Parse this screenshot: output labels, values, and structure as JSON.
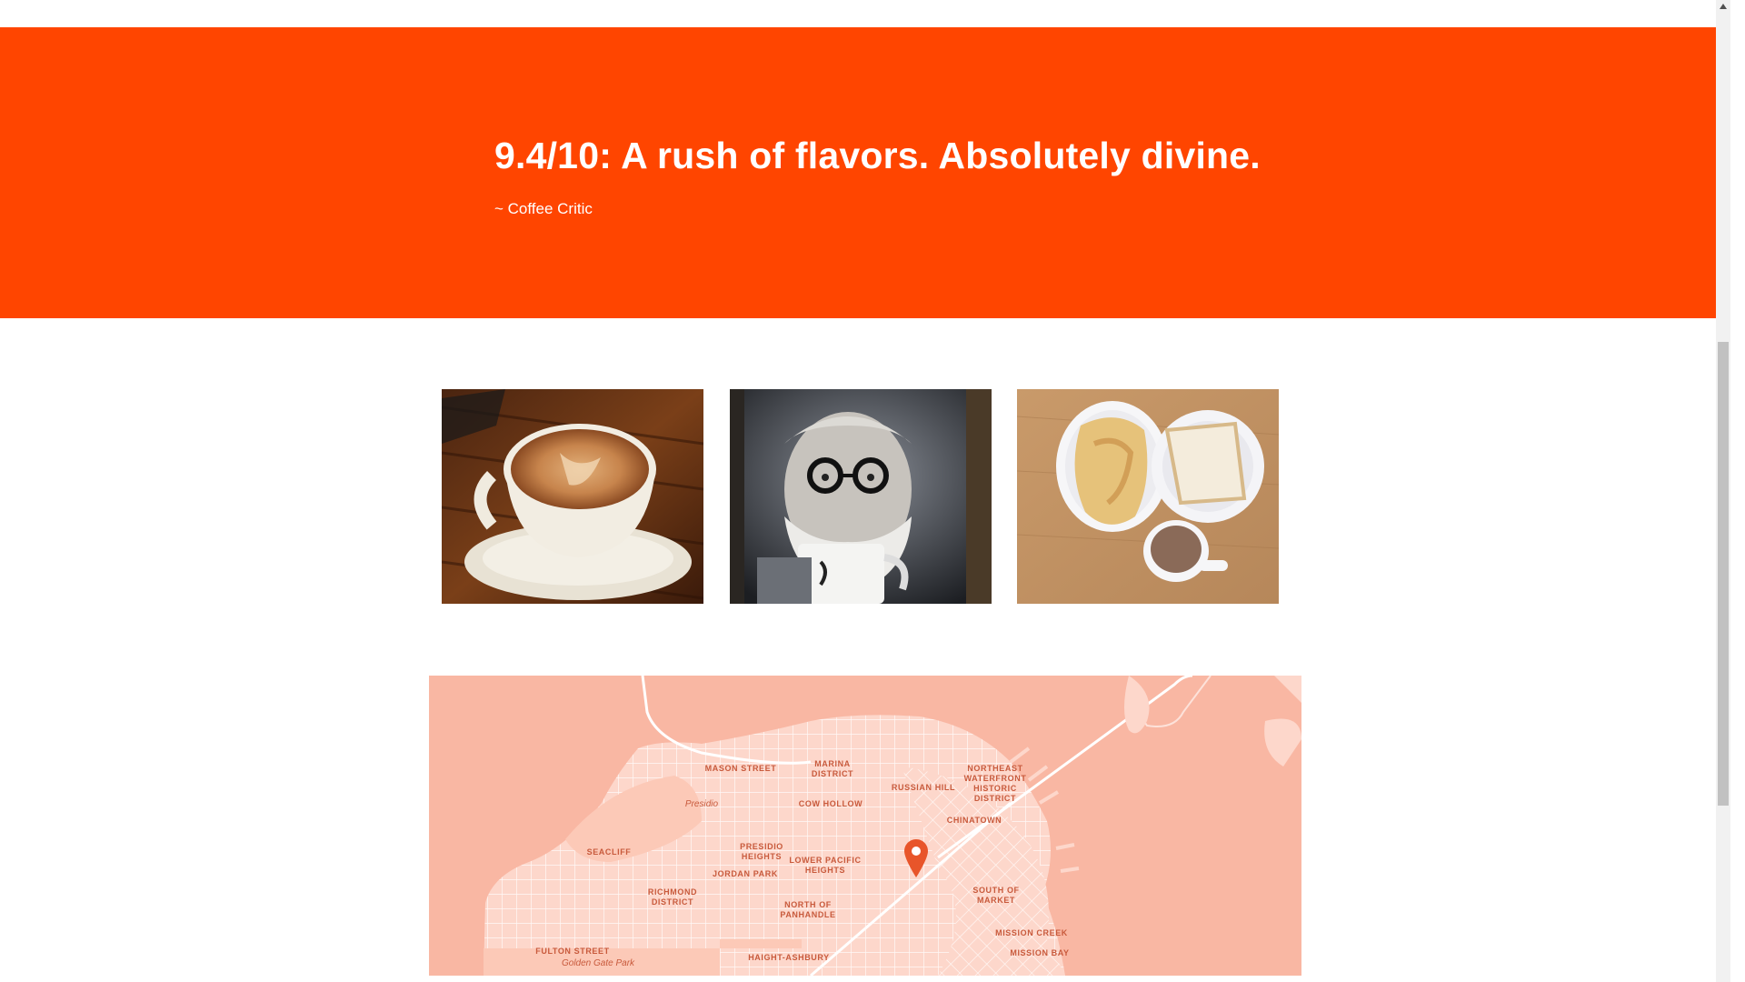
{
  "quote": {
    "text": "9.4/10: A rush of flavors. Absolutely divine.",
    "author": "~ Coffee Critic"
  },
  "gallery": {
    "photos": [
      {
        "subject": "cappuccino-cup"
      },
      {
        "subject": "bearded-man-with-mug-portrait"
      },
      {
        "subject": "breakfast-plates-with-coffee"
      }
    ]
  },
  "map": {
    "labels": {
      "marina": "MARINA\nDISTRICT",
      "mason": "MASON STREET",
      "presidio": "Presidio",
      "cow_hollow": "COW HOLLOW",
      "russian_hill": "RUSSIAN HILL",
      "northeast": "NORTHEAST\nWATERFRONT\nHISTORIC\nDISTRICT",
      "chinatown": "CHINATOWN",
      "seacliff": "SEACLIFF",
      "presidio_heights": "PRESIDIO\nHEIGHTS",
      "lower_pacific": "LOWER PACIFIC\nHEIGHTS",
      "jordan_park": "JORDAN PARK",
      "richmond": "RICHMOND\nDISTRICT",
      "north_panhandle": "NORTH OF\nPANHANDLE",
      "south_market": "SOUTH OF\nMARKET",
      "mission_creek": "MISSION CREEK",
      "mission_bay": "MISSION BAY",
      "fulton": "FULTON STREET",
      "golden_gate_park": "Golden Gate Park",
      "haight": "HAIGHT-ASHBURY"
    },
    "pin_color": "#e8552a"
  },
  "colors": {
    "accent": "#ff4500",
    "map_water": "#f9b7a3",
    "map_land": "#fdd7cb"
  }
}
